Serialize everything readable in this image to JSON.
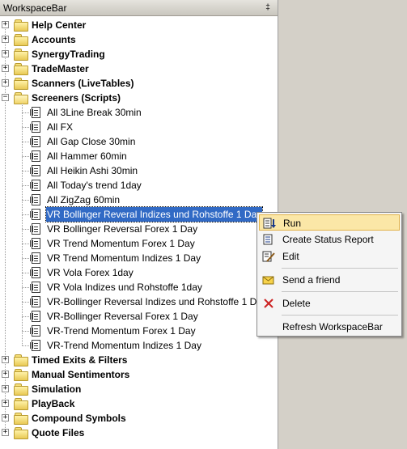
{
  "window": {
    "title": "WorkspaceBar",
    "pin_glyph": "‡"
  },
  "groups_top": [
    {
      "label": "Help Center",
      "state": "collapsed"
    },
    {
      "label": "Accounts",
      "state": "collapsed"
    },
    {
      "label": "SynergyTrading",
      "state": "collapsed"
    },
    {
      "label": "TradeMaster",
      "state": "collapsed"
    },
    {
      "label": "Scanners (LiveTables)",
      "state": "collapsed"
    },
    {
      "label": "Screeners (Scripts)",
      "state": "expanded"
    }
  ],
  "scripts": [
    "All 3Line Break 30min",
    "All FX",
    "All Gap Close 30min",
    "All Hammer 60min",
    "All Heikin Ashi 30min",
    "All Today's trend 1day",
    "All ZigZag 60min",
    "VR Bollinger Reveral Indizes und Rohstoffe 1 Day",
    "VR Bollinger Reversal Forex 1 Day",
    "VR Trend Momentum Forex 1 Day",
    "VR Trend Momentum Indizes 1 Day",
    "VR Vola Forex 1day",
    "VR Vola Indizes und Rohstoffe 1day",
    "VR-Bollinger Reversal Indizes und Rohstoffe 1 Day",
    "VR-Bollinger Reversal Forex 1 Day",
    "VR-Trend Momentum Forex 1 Day",
    "VR-Trend Momentum Indizes 1 Day"
  ],
  "selected_script_index": 7,
  "groups_bottom": [
    {
      "label": "Timed Exits & Filters",
      "state": "collapsed"
    },
    {
      "label": "Manual Sentimentors",
      "state": "collapsed"
    },
    {
      "label": "Simulation",
      "state": "collapsed"
    },
    {
      "label": "PlayBack",
      "state": "collapsed"
    },
    {
      "label": "Compound Symbols",
      "state": "collapsed"
    },
    {
      "label": "Quote Files",
      "state": "collapsed"
    }
  ],
  "context_menu": {
    "run": {
      "label": "Run",
      "icon": "run-icon"
    },
    "create_status_report": {
      "label": "Create Status Report",
      "icon": "report-icon"
    },
    "edit": {
      "label": "Edit",
      "icon": "edit-icon"
    },
    "send_friend": {
      "label": "Send a friend",
      "icon": "envelope-icon"
    },
    "delete": {
      "label": "Delete",
      "icon": "delete-x-icon"
    },
    "refresh": {
      "label": "Refresh WorkspaceBar"
    }
  },
  "colors": {
    "selection": "#316ac5",
    "menu_highlight": "#fbe7a7",
    "delete_red": "#cc2222"
  }
}
